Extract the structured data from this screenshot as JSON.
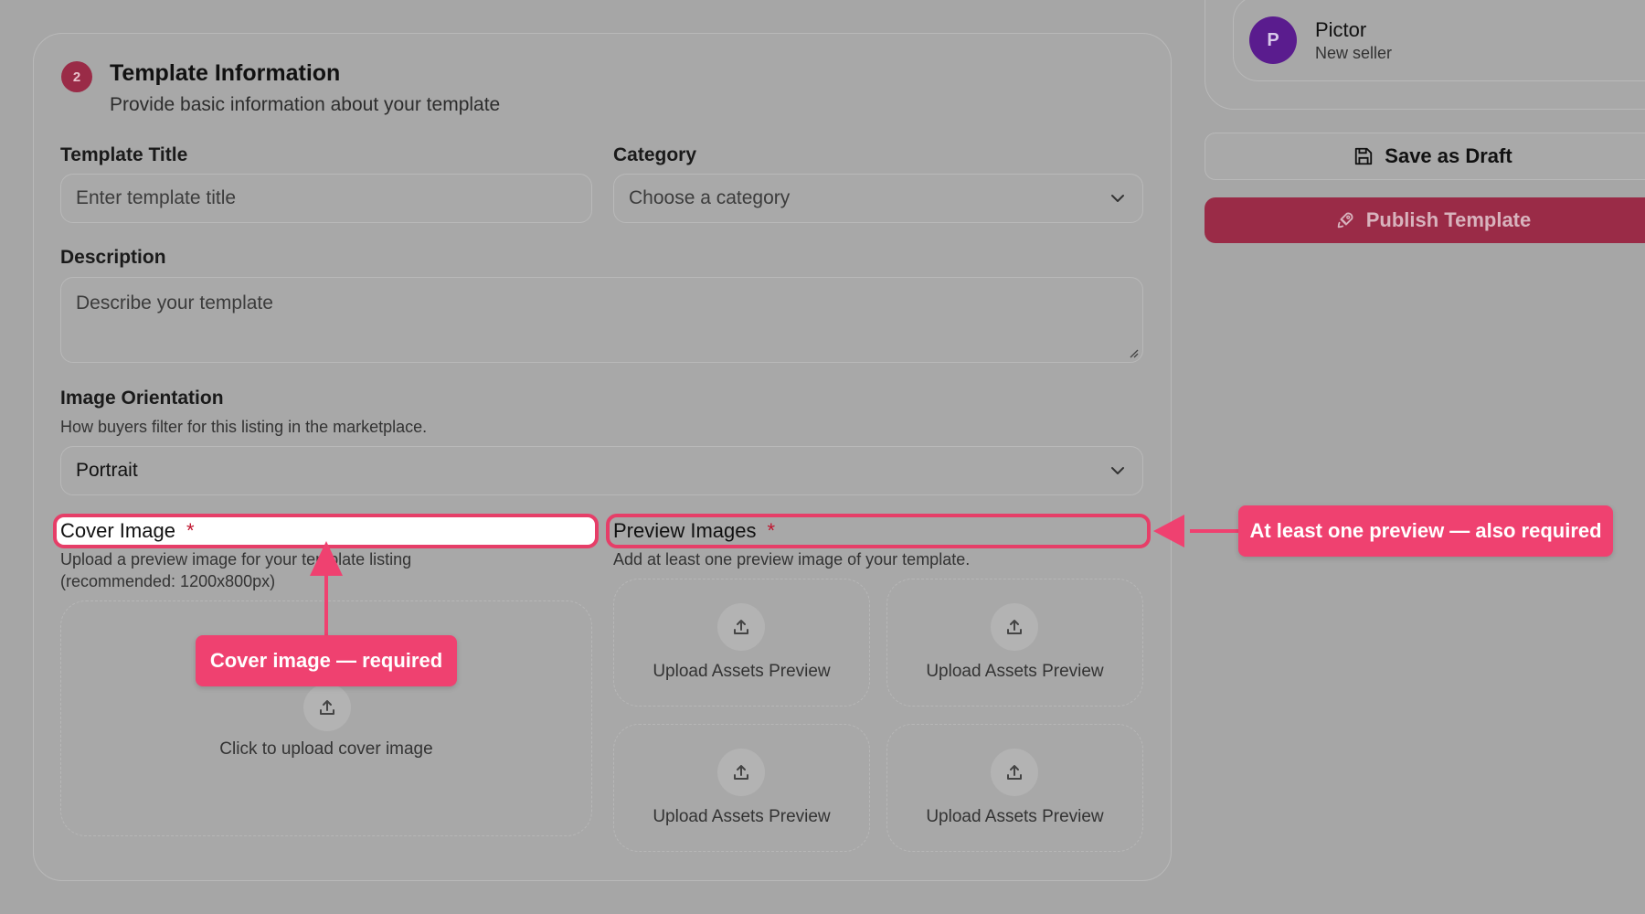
{
  "section": {
    "step_number": "2",
    "title": "Template Information",
    "subtitle": "Provide basic information about your template"
  },
  "form": {
    "title_label": "Template Title",
    "title_placeholder": "Enter template title",
    "category_label": "Category",
    "category_placeholder": "Choose a category",
    "description_label": "Description",
    "description_placeholder": "Describe your template",
    "orientation_label": "Image Orientation",
    "orientation_helper": "How buyers filter for this listing in the marketplace.",
    "orientation_value": "Portrait",
    "cover_label": "Cover Image",
    "cover_required": "*",
    "cover_helper_line1": "Upload a preview image for your template listing",
    "cover_helper_line2": "(recommended: 1200x800px)",
    "cover_upload_text": "Click to upload cover image",
    "preview_label": "Preview Images",
    "preview_required": "*",
    "preview_helper": "Add at least one preview image of your template.",
    "preview_slots": [
      "Upload Assets Preview",
      "Upload Assets Preview",
      "Upload Assets Preview",
      "Upload Assets Preview"
    ]
  },
  "seller": {
    "initial": "P",
    "name": "Pictor",
    "role": "New seller"
  },
  "actions": {
    "save_draft": "Save as Draft",
    "publish": "Publish Template"
  },
  "annotations": {
    "cover_callout": "Cover image — required",
    "preview_callout": "At least one preview — also required"
  },
  "colors": {
    "accent": "#ef4170",
    "publish": "#9a2b47",
    "avatar": "#5a1c8e"
  }
}
